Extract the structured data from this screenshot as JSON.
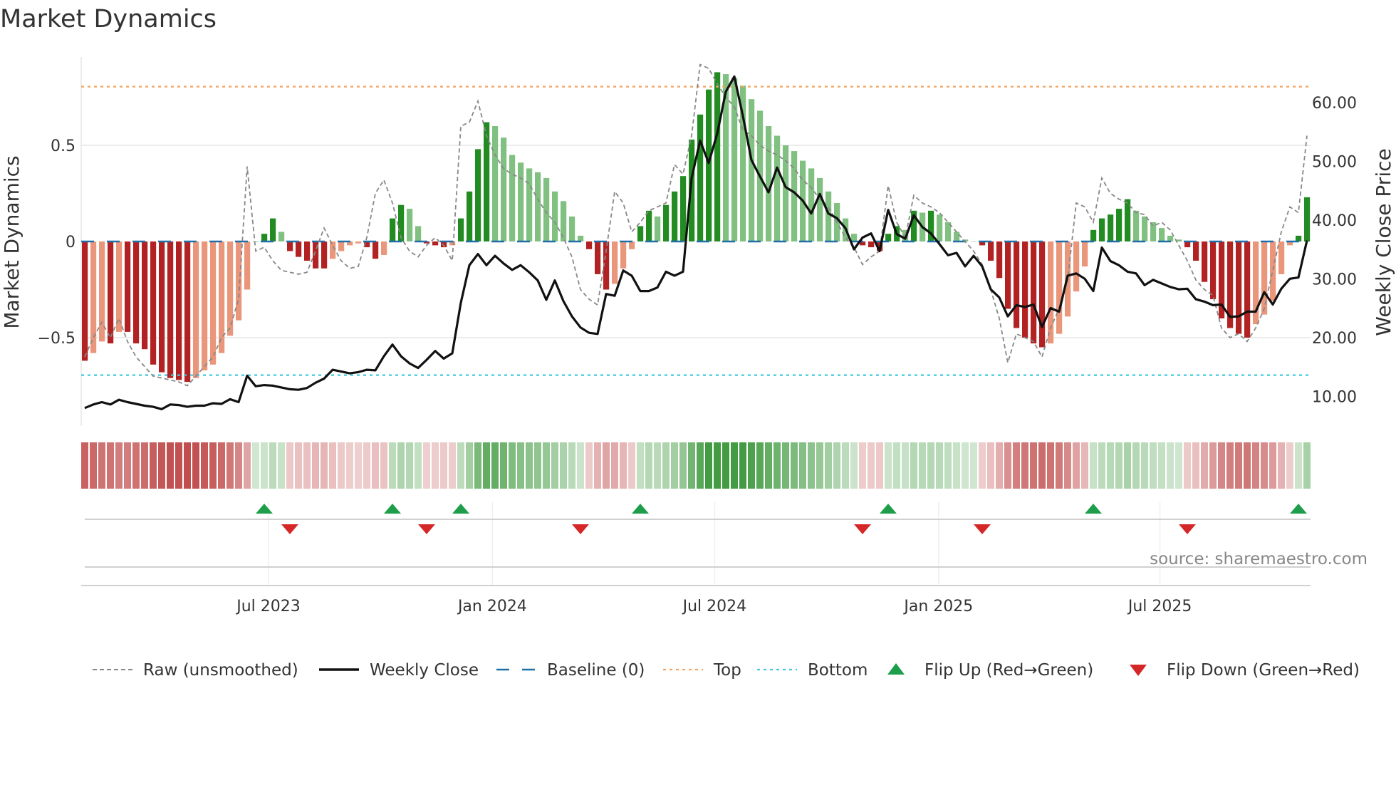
{
  "chart_data": {
    "type": "bar",
    "title": "Market Dynamics",
    "ylabel": "Market Dynamics",
    "y2label": "Weekly Close Price",
    "ylim": [
      -0.9,
      0.95
    ],
    "y2lim": [
      5,
      70
    ],
    "yticks": [
      {
        "v": 0.5,
        "label": "0.5"
      },
      {
        "v": 0,
        "label": "0"
      },
      {
        "v": -0.5,
        "label": "−0.5"
      }
    ],
    "y2ticks": [
      {
        "v": 60,
        "label": "60.00"
      },
      {
        "v": 50,
        "label": "50.00"
      },
      {
        "v": 40,
        "label": "40.00"
      },
      {
        "v": 30,
        "label": "30.00"
      },
      {
        "v": 20,
        "label": "20.00"
      },
      {
        "v": 10,
        "label": "10.00"
      }
    ],
    "xticks": [
      {
        "week": 21.5,
        "label": "Jul 2023"
      },
      {
        "week": 47.7,
        "label": "Jan 2024"
      },
      {
        "week": 73.7,
        "label": "Jul 2024"
      },
      {
        "week": 99.9,
        "label": "Jan 2025"
      },
      {
        "week": 125.8,
        "label": "Jul 2025"
      }
    ],
    "top_level": 0.805,
    "bottom_level": -0.695,
    "baseline": 0,
    "momentum": [
      -0.62,
      -0.58,
      -0.52,
      -0.53,
      -0.47,
      -0.47,
      -0.53,
      -0.56,
      -0.64,
      -0.68,
      -0.71,
      -0.72,
      -0.73,
      -0.71,
      -0.67,
      -0.64,
      -0.58,
      -0.49,
      -0.41,
      -0.25,
      0.0,
      0.04,
      0.12,
      0.05,
      -0.05,
      -0.08,
      -0.1,
      -0.14,
      -0.14,
      -0.09,
      -0.05,
      -0.02,
      -0.01,
      -0.03,
      -0.09,
      -0.07,
      0.12,
      0.19,
      0.17,
      0.08,
      -0.01,
      -0.02,
      -0.03,
      -0.02,
      0.12,
      0.26,
      0.48,
      0.62,
      0.6,
      0.54,
      0.45,
      0.41,
      0.38,
      0.36,
      0.33,
      0.26,
      0.21,
      0.13,
      0.03,
      -0.04,
      -0.17,
      -0.25,
      -0.22,
      -0.14,
      -0.04,
      0.08,
      0.16,
      0.13,
      0.19,
      0.26,
      0.34,
      0.53,
      0.66,
      0.79,
      0.88,
      0.87,
      0.85,
      0.81,
      0.74,
      0.68,
      0.6,
      0.55,
      0.5,
      0.47,
      0.42,
      0.38,
      0.33,
      0.26,
      0.2,
      0.12,
      0.04,
      -0.02,
      -0.03,
      -0.05,
      0.04,
      0.08,
      0.06,
      0.16,
      0.15,
      0.16,
      0.14,
      0.1,
      0.05,
      0.01,
      0.0,
      -0.02,
      -0.1,
      -0.19,
      -0.35,
      -0.45,
      -0.5,
      -0.53,
      -0.55,
      -0.53,
      -0.48,
      -0.39,
      -0.26,
      -0.13,
      0.06,
      0.12,
      0.14,
      0.17,
      0.22,
      0.16,
      0.13,
      0.1,
      0.07,
      0.03,
      0.01,
      -0.03,
      -0.1,
      -0.21,
      -0.3,
      -0.4,
      -0.45,
      -0.48,
      -0.5,
      -0.43,
      -0.38,
      -0.31,
      -0.17,
      -0.02,
      0.03,
      0.23
    ],
    "raw": [
      -0.6,
      -0.5,
      -0.42,
      -0.5,
      -0.4,
      -0.52,
      -0.6,
      -0.65,
      -0.7,
      -0.71,
      -0.72,
      -0.73,
      -0.75,
      -0.7,
      -0.65,
      -0.6,
      -0.5,
      -0.45,
      -0.3,
      0.39,
      -0.05,
      -0.03,
      -0.1,
      -0.15,
      -0.16,
      -0.17,
      -0.16,
      -0.05,
      0.07,
      -0.02,
      -0.1,
      -0.14,
      -0.13,
      0.02,
      0.25,
      0.32,
      0.2,
      0.02,
      -0.05,
      -0.08,
      -0.02,
      0.02,
      -0.02,
      -0.1,
      0.6,
      0.62,
      0.73,
      0.55,
      0.45,
      0.38,
      0.35,
      0.33,
      0.3,
      0.22,
      0.15,
      0.1,
      0.02,
      -0.08,
      -0.25,
      -0.3,
      -0.33,
      -0.05,
      0.26,
      0.2,
      0.05,
      0.1,
      0.16,
      0.18,
      0.2,
      0.4,
      0.35,
      0.55,
      0.92,
      0.9,
      0.82,
      0.75,
      0.7,
      0.58,
      0.55,
      0.5,
      0.47,
      0.45,
      0.42,
      0.38,
      0.32,
      0.28,
      0.22,
      0.18,
      0.1,
      0.02,
      -0.03,
      -0.12,
      -0.08,
      -0.05,
      0.29,
      0.1,
      0.02,
      0.24,
      0.2,
      0.18,
      0.15,
      0.1,
      0.05,
      0.0,
      -0.05,
      -0.12,
      -0.25,
      -0.4,
      -0.63,
      -0.48,
      -0.5,
      -0.52,
      -0.6,
      -0.45,
      -0.35,
      -0.2,
      0.2,
      0.18,
      0.1,
      0.33,
      0.25,
      0.22,
      0.2,
      0.15,
      0.14,
      0.08,
      0.1,
      0.06,
      -0.02,
      -0.1,
      -0.2,
      -0.25,
      -0.28,
      -0.45,
      -0.5,
      -0.48,
      -0.52,
      -0.45,
      -0.35,
      -0.15,
      0.05,
      0.18,
      0.15,
      0.55
    ],
    "close": [
      8.0,
      8.6,
      9.0,
      8.6,
      9.4,
      9.0,
      8.7,
      8.4,
      8.2,
      7.8,
      8.6,
      8.5,
      8.2,
      8.4,
      8.4,
      8.8,
      8.7,
      9.5,
      9.0,
      13.5,
      11.7,
      11.9,
      11.8,
      11.5,
      11.2,
      11.1,
      11.4,
      12.3,
      13.0,
      14.5,
      14.2,
      13.9,
      14.1,
      14.5,
      14.4,
      16.8,
      18.8,
      16.8,
      15.6,
      14.8,
      16.2,
      17.7,
      16.4,
      17.3,
      25.9,
      32.3,
      34.2,
      32.3,
      33.9,
      32.6,
      31.5,
      32.3,
      31.1,
      29.7,
      26.4,
      29.7,
      26.2,
      23.6,
      21.7,
      20.8,
      20.6,
      27.4,
      27.1,
      31.4,
      30.5,
      27.9,
      27.9,
      28.5,
      31.2,
      30.5,
      31.2,
      47.1,
      53.5,
      49.7,
      54.7,
      61.8,
      64.4,
      57.7,
      50.2,
      47.4,
      44.7,
      48.9,
      45.6,
      44.7,
      43.3,
      41.1,
      44.4,
      41.1,
      40.3,
      38.6,
      35.0,
      37.0,
      37.7,
      34.7,
      41.7,
      37.6,
      36.8,
      40.8,
      38.8,
      37.7,
      35.9,
      34.0,
      34.4,
      32.1,
      33.9,
      32.1,
      28.2,
      26.8,
      23.6,
      25.5,
      25.2,
      25.6,
      21.8,
      25.0,
      24.4,
      30.5,
      30.9,
      30.0,
      27.9,
      35.3,
      33.0,
      32.3,
      31.2,
      30.9,
      28.9,
      29.8,
      29.2,
      28.6,
      28.2,
      28.3,
      26.5,
      26.1,
      25.5,
      25.6,
      23.5,
      23.6,
      24.4,
      24.4,
      27.7,
      25.6,
      28.3,
      30.0,
      30.2,
      36.5
    ],
    "flips_up": [
      21,
      36,
      44,
      65,
      94,
      118,
      142
    ],
    "flips_down": [
      24,
      40,
      58,
      91,
      105,
      129
    ],
    "legend": [
      {
        "key": "raw",
        "label": "Raw (unsmoothed)"
      },
      {
        "key": "close",
        "label": "Weekly Close"
      },
      {
        "key": "baseline",
        "label": "Baseline (0)"
      },
      {
        "key": "top",
        "label": "Top"
      },
      {
        "key": "bottom",
        "label": "Bottom"
      },
      {
        "key": "flip_up",
        "label": "Flip Up (Red→Green)"
      },
      {
        "key": "flip_down",
        "label": "Flip Down (Green→Red)"
      }
    ],
    "legend_position": "bottom",
    "source": "source: sharemaestro.com"
  },
  "colors": {
    "pos_strong": "#228b22",
    "pos_weak": "#80c080",
    "neg_strong": "#b22222",
    "neg_weak": "#e9967a",
    "top": "#f4a460",
    "bottom": "#40c8e0",
    "baseline": "#1f6fa8",
    "close": "#111111",
    "raw": "#888888",
    "flip_up": "#1e9e4a",
    "flip_down": "#d62728"
  }
}
